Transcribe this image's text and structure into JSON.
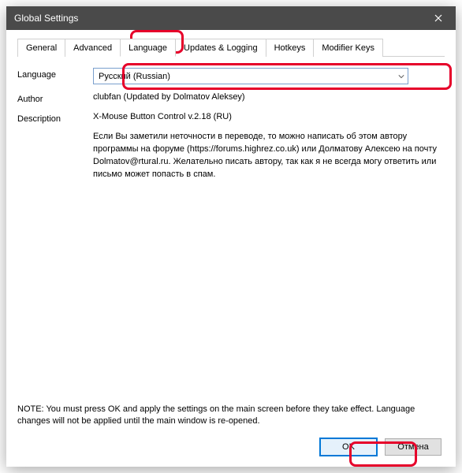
{
  "window": {
    "title": "Global Settings"
  },
  "tabs": {
    "items": [
      "General",
      "Advanced",
      "Language",
      "Updates & Logging",
      "Hotkeys",
      "Modifier Keys"
    ],
    "active": 2
  },
  "form": {
    "language_label": "Language",
    "language_value": "Русский (Russian)",
    "author_label": "Author",
    "author_value": "clubfan (Updated by Dolmatov Aleksey)",
    "description_label": "Description",
    "description_title": "X-Mouse Button Control v.2.18 (RU)",
    "description_body": "Если Вы заметили неточности в переводе, то можно написать об этом автору программы на форуме (https://forums.highrez.co.uk) или Долматову Алексею на почту Dolmatov@rtural.ru. Желательно писать автору, так как я не всегда могу ответить или письмо может попасть в спам."
  },
  "note": "NOTE: You must press OK and apply the settings on the main screen before they take effect. Language changes will not be applied until the main window is re-opened.",
  "buttons": {
    "ok": "OK",
    "cancel": "Отмена"
  }
}
